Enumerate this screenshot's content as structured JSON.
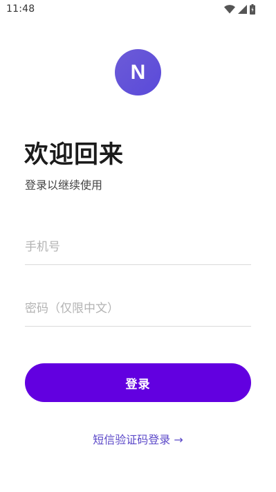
{
  "status_bar": {
    "time": "11:48",
    "icons": [
      "wifi-icon",
      "signal-icon",
      "battery-icon"
    ]
  },
  "avatar": {
    "initial": "N",
    "color": "#5f50d9"
  },
  "header": {
    "title": "欢迎回来",
    "subtitle": "登录以继续使用"
  },
  "form": {
    "phone": {
      "value": "",
      "placeholder": "手机号"
    },
    "password": {
      "value": "",
      "placeholder": "密码（仅限中文）"
    },
    "login_label": "登录",
    "login_color": "#6200e0"
  },
  "links": {
    "sms_login": "短信验证码登录 →",
    "sms_color": "#5b48c8"
  }
}
